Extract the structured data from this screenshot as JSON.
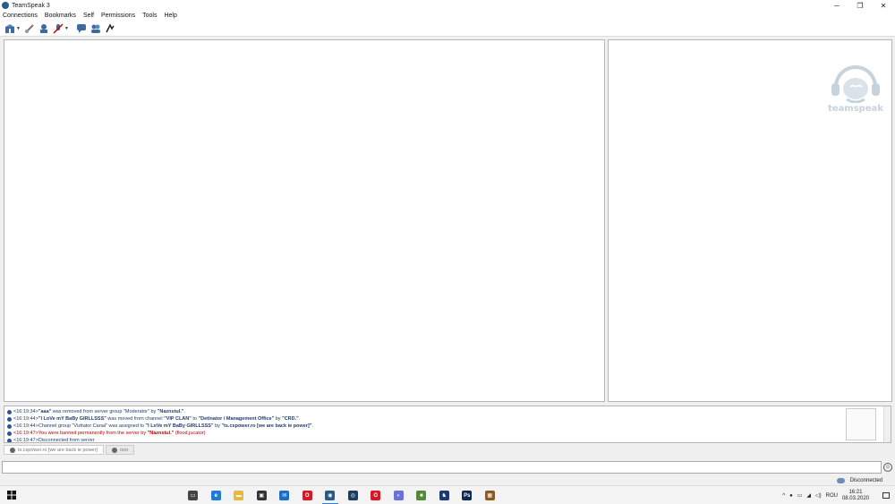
{
  "window": {
    "title": "TeamSpeak 3",
    "controls": [
      "─",
      "❐",
      "✕"
    ]
  },
  "menu": [
    "Connections",
    "Bookmarks",
    "Self",
    "Permissions",
    "Tools",
    "Help"
  ],
  "toolbar": {
    "buttons": [
      "connect-icon",
      "disconnect-icon",
      "away-icon",
      "mute-microphone-icon",
      "chat-icon",
      "contacts-icon",
      "whisper-icon"
    ]
  },
  "server_view": {
    "logo_text": "teamspeak"
  },
  "log": {
    "lines": [
      {
        "time": "<16:19:34>",
        "parts": [
          {
            "t": "\"aaa\"",
            "b": true
          },
          {
            "t": " was removed from server group \"Moderator\" by "
          },
          {
            "t": "\"Naznstul.\"",
            "b": true
          },
          {
            "t": "."
          }
        ],
        "color": "#1f3c73"
      },
      {
        "time": "<16:19:44>",
        "parts": [
          {
            "t": "\"I LoVe mY BaBy GIRLLSSS\"",
            "b": true
          },
          {
            "t": " was moved from channel "
          },
          {
            "t": "\"VIP CLAN\"",
            "b": true
          },
          {
            "t": " to "
          },
          {
            "t": "\"Detinator / Management Office\"",
            "b": true
          },
          {
            "t": " by "
          },
          {
            "t": "\"CRD.\"",
            "b": true
          },
          {
            "t": "."
          }
        ],
        "color": "#1f3c73"
      },
      {
        "time": "<16:19:44>",
        "parts": [
          {
            "t": "Channel group \"Vizitator Canal\" was assigned to "
          },
          {
            "t": "\"I LoVe mY BaBy GIRLLSSS\"",
            "b": true
          },
          {
            "t": " by "
          },
          {
            "t": "\"ts.cspower.ro [we are back ie power]\"",
            "b": true
          },
          {
            "t": "."
          }
        ],
        "color": "#1f3c73"
      },
      {
        "time": "<16:19:47>",
        "parts": [
          {
            "t": "You were banned permanently from the server by "
          },
          {
            "t": "\"Naznstul.\"",
            "b": true
          },
          {
            "t": " (flood,jucator)"
          }
        ],
        "color": "#c00000"
      },
      {
        "time": "<16:19:47>",
        "parts": [
          {
            "t": "Disconnected from server"
          }
        ],
        "color": "#1f3c73"
      }
    ]
  },
  "tabs": [
    {
      "label": "ts.cspower.ro [we are back ie power]"
    },
    {
      "label": "ooo"
    }
  ],
  "chat": {
    "placeholder": "",
    "value": ""
  },
  "status": {
    "text": "Disconnected"
  },
  "taskbar": {
    "apps": [
      {
        "name": "task-view-icon",
        "color": "#444",
        "glyph": "▭"
      },
      {
        "name": "edge-icon",
        "color": "#1f7bd8",
        "glyph": "e"
      },
      {
        "name": "file-explorer-icon",
        "color": "#e8b93b",
        "glyph": "▬"
      },
      {
        "name": "store-icon",
        "color": "#333",
        "glyph": "▣"
      },
      {
        "name": "mail-icon",
        "color": "#1c6dc9",
        "glyph": "✉"
      },
      {
        "name": "opera-icon",
        "color": "#d41a25",
        "glyph": "O"
      },
      {
        "name": "teamspeak-icon",
        "color": "#2a5a8a",
        "glyph": "◉",
        "active": true
      },
      {
        "name": "steam-icon",
        "color": "#1b3d5e",
        "glyph": "◎"
      },
      {
        "name": "opera-gx-icon",
        "color": "#d41a25",
        "glyph": "O"
      },
      {
        "name": "discord-icon",
        "color": "#6a72d8",
        "glyph": "◐"
      },
      {
        "name": "minecraft-icon",
        "color": "#4f8a34",
        "glyph": "■"
      },
      {
        "name": "app-icon",
        "color": "#1a3a70",
        "glyph": "♞"
      },
      {
        "name": "photoshop-icon",
        "color": "#0f2a4d",
        "glyph": "Ps"
      },
      {
        "name": "package-icon",
        "color": "#8a5a22",
        "glyph": "▦"
      }
    ],
    "tray": {
      "language": "ROU",
      "time": "16:21",
      "date": "08.03.2020"
    }
  }
}
